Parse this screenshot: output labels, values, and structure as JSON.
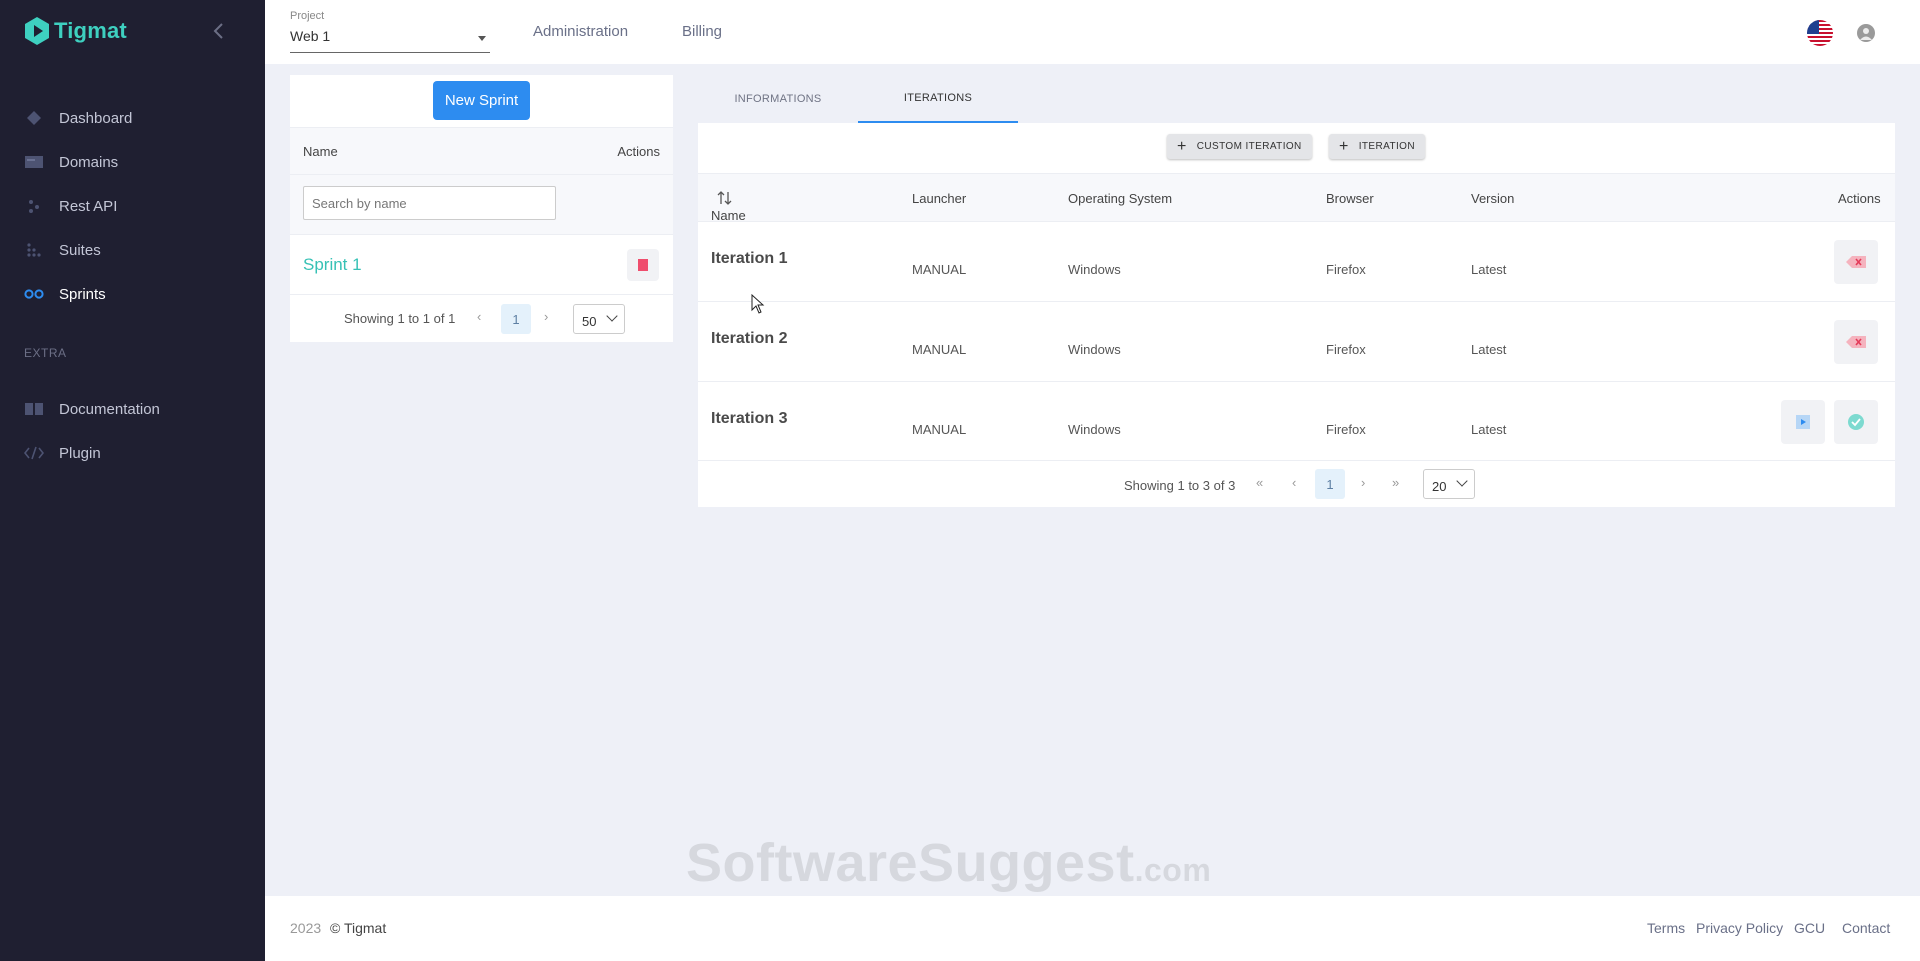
{
  "app": {
    "name": "Tigmat",
    "brand_color": "#3ed0c0",
    "accent_color": "#2d8cf0"
  },
  "sidebar": {
    "items": [
      {
        "label": "Dashboard",
        "icon": "diamond-icon",
        "active": false
      },
      {
        "label": "Domains",
        "icon": "card-icon",
        "active": false
      },
      {
        "label": "Rest API",
        "icon": "dots-icon",
        "active": false
      },
      {
        "label": "Suites",
        "icon": "grid-dots-icon",
        "active": false
      },
      {
        "label": "Sprints",
        "icon": "rings-icon",
        "active": true
      }
    ],
    "extra_heading": "EXTRA",
    "extra_items": [
      {
        "label": "Documentation",
        "icon": "book-icon"
      },
      {
        "label": "Plugin",
        "icon": "code-icon"
      }
    ]
  },
  "topbar": {
    "project_label": "Project",
    "project_value": "Web 1",
    "links": [
      "Administration",
      "Billing"
    ],
    "language_icon": "us-flag-icon",
    "user_icon": "user-avatar-icon"
  },
  "sprints": {
    "new_button": "New Sprint",
    "columns": {
      "name": "Name",
      "actions": "Actions"
    },
    "search_placeholder": "Search by name",
    "rows": [
      {
        "name": "Sprint 1"
      }
    ],
    "pager": {
      "text": "Showing 1 to 1 of 1",
      "page": "1",
      "size": "50"
    }
  },
  "tabs": [
    {
      "label": "INFORMATIONS",
      "active": false
    },
    {
      "label": "ITERATIONS",
      "active": true
    }
  ],
  "iterations": {
    "buttons": {
      "custom": "CUSTOM ITERATION",
      "iteration": "ITERATION"
    },
    "columns": {
      "name": "Name",
      "launcher": "Launcher",
      "os": "Operating System",
      "browser": "Browser",
      "version": "Version",
      "actions": "Actions"
    },
    "rows": [
      {
        "name": "Iteration 1",
        "launcher": "MANUAL",
        "os": "Windows",
        "browser": "Firefox",
        "version": "Latest"
      },
      {
        "name": "Iteration 2",
        "launcher": "MANUAL",
        "os": "Windows",
        "browser": "Firefox",
        "version": "Latest"
      },
      {
        "name": "Iteration 3",
        "launcher": "MANUAL",
        "os": "Windows",
        "browser": "Firefox",
        "version": "Latest"
      }
    ],
    "pager": {
      "text": "Showing 1 to 3 of 3",
      "page": "1",
      "size": "20"
    }
  },
  "watermark": {
    "main": "SoftwareSuggest",
    "suffix": ".com"
  },
  "footer": {
    "year": "2023",
    "copyright": "© Tigmat",
    "links": [
      "Terms",
      "Privacy Policy",
      "GCU",
      "Contact"
    ]
  }
}
